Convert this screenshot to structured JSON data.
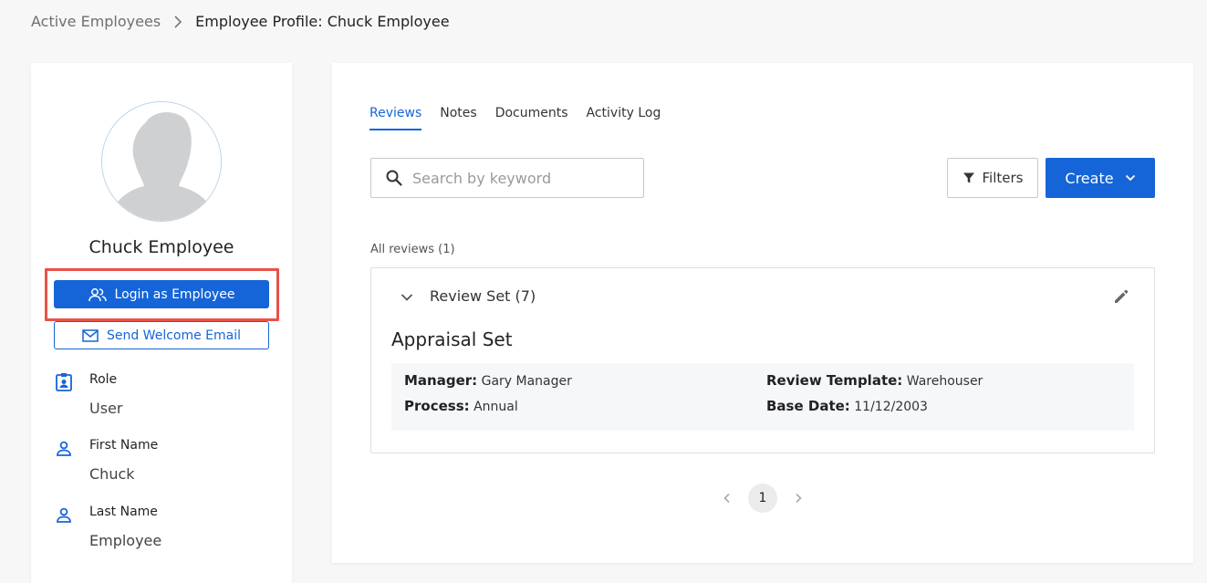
{
  "breadcrumb": {
    "parent": "Active Employees",
    "current": "Employee Profile: Chuck Employee"
  },
  "profile": {
    "name": "Chuck Employee",
    "login_button": "Login as Employee",
    "welcome_button": "Send Welcome Email",
    "fields": [
      {
        "label": "Role",
        "value": "User",
        "icon": "badge-icon"
      },
      {
        "label": "First Name",
        "value": "Chuck",
        "icon": "person-icon"
      },
      {
        "label": "Last Name",
        "value": "Employee",
        "icon": "person-icon"
      }
    ]
  },
  "tabs": [
    {
      "label": "Reviews",
      "active": true
    },
    {
      "label": "Notes",
      "active": false
    },
    {
      "label": "Documents",
      "active": false
    },
    {
      "label": "Activity Log",
      "active": false
    }
  ],
  "search": {
    "placeholder": "Search by keyword",
    "value": ""
  },
  "toolbar": {
    "filters_label": "Filters",
    "create_label": "Create"
  },
  "reviews": {
    "count_label": "All reviews (1)",
    "set_title": "Review Set (7)",
    "appraisal_title": "Appraisal Set",
    "details": {
      "manager_label": "Manager:",
      "manager_value": "Gary Manager",
      "template_label": "Review Template:",
      "template_value": "Warehouser",
      "process_label": "Process:",
      "process_value": "Annual",
      "base_date_label": "Base Date:",
      "base_date_value": "11/12/2003"
    }
  },
  "pagination": {
    "current_page": "1"
  },
  "colors": {
    "primary": "#1565d8",
    "highlight": "#e8514a"
  }
}
